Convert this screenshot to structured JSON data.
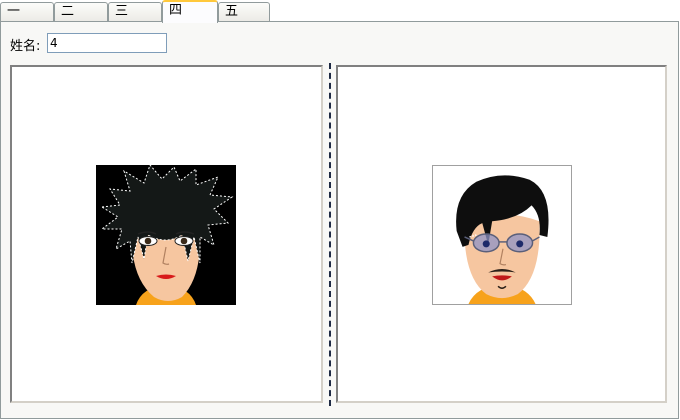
{
  "tabs": [
    {
      "label": "一",
      "active": false
    },
    {
      "label": "二",
      "active": false
    },
    {
      "label": "三",
      "active": false
    },
    {
      "label": "四",
      "active": true
    },
    {
      "label": "五",
      "active": false
    }
  ],
  "form": {
    "name_label": "姓名:",
    "name_value": "4"
  },
  "avatars": {
    "left": "spiky-hair-cartoon-face",
    "right": "glasses-mustache-cartoon-face"
  },
  "colors": {
    "active_tab_accent": "#ffc83c",
    "tab_border": "#919b9c",
    "divider": "#1e2a44"
  }
}
